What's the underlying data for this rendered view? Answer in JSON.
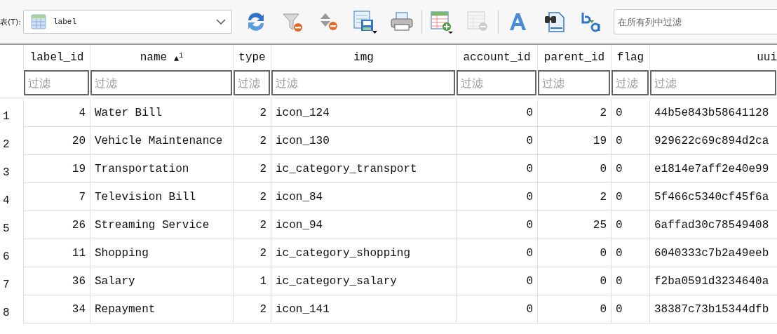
{
  "toolbar": {
    "table_label": "表(T):",
    "table_name": "label",
    "groups": [
      [
        {
          "kind": "refresh",
          "disabled": false
        },
        {
          "kind": "clear-filter",
          "disabled": false
        },
        {
          "kind": "clear-sort",
          "disabled": false
        },
        {
          "kind": "save",
          "disabled": false
        },
        {
          "kind": "print",
          "disabled": false
        }
      ],
      [
        {
          "kind": "add-record",
          "disabled": false
        },
        {
          "kind": "delete-record",
          "disabled": true
        }
      ],
      [
        {
          "kind": "font",
          "disabled": false
        },
        {
          "kind": "find",
          "disabled": false
        },
        {
          "kind": "replace",
          "disabled": false
        }
      ]
    ],
    "filter_placeholder": "在所有列中过滤"
  },
  "table": {
    "columns": [
      {
        "label": "label_id",
        "kind": "number",
        "filter_placeholder": "过滤"
      },
      {
        "label": "name",
        "kind": "text",
        "sort": "▲$^{1}$",
        "filter_placeholder": "过滤"
      },
      {
        "label": "type",
        "kind": "number",
        "filter_placeholder": "过滤"
      },
      {
        "label": "img",
        "kind": "text",
        "filter_placeholder": "过滤"
      },
      {
        "label": "account_id",
        "kind": "number",
        "filter_placeholder": "过滤"
      },
      {
        "label": "parent_id",
        "kind": "number",
        "filter_placeholder": "过滤"
      },
      {
        "label": "flag",
        "kind": "text",
        "filter_placeholder": "过滤"
      },
      {
        "label": "uui",
        "kind": "text",
        "filter_placeholder": "过滤"
      }
    ],
    "rows": [
      {
        "number": "1",
        "cells": [
          "4",
          "Water Bill",
          "2",
          "icon_124",
          "0",
          "2",
          "0",
          "44b5e843b58641128"
        ]
      },
      {
        "number": "2",
        "cells": [
          "20",
          "Vehicle Maintenance",
          "2",
          "icon_130",
          "0",
          "19",
          "0",
          "929622c69c894d2ca"
        ]
      },
      {
        "number": "3",
        "cells": [
          "19",
          "Transportation",
          "2",
          "ic_category_transport",
          "0",
          "0",
          "0",
          "e1814e7aff2e40e99"
        ]
      },
      {
        "number": "4",
        "cells": [
          "7",
          "Television Bill",
          "2",
          "icon_84",
          "0",
          "2",
          "0",
          "5f466c5340cf45f6a"
        ]
      },
      {
        "number": "5",
        "cells": [
          "26",
          "Streaming Service",
          "2",
          "icon_94",
          "0",
          "25",
          "0",
          "6affad30c78549408"
        ]
      },
      {
        "number": "6",
        "cells": [
          "11",
          "Shopping",
          "2",
          "ic_category_shopping",
          "0",
          "0",
          "0",
          "6040333c7b2a49eeb"
        ]
      },
      {
        "number": "7",
        "cells": [
          "36",
          "Salary",
          "1",
          "ic_category_salary",
          "0",
          "0",
          "0",
          "f2ba0591d3234640a"
        ]
      },
      {
        "number": "8",
        "cells": [
          "34",
          "Repayment",
          "2",
          "icon_141",
          "0",
          "0",
          "0",
          "38387c73b15344dfb"
        ]
      }
    ]
  }
}
